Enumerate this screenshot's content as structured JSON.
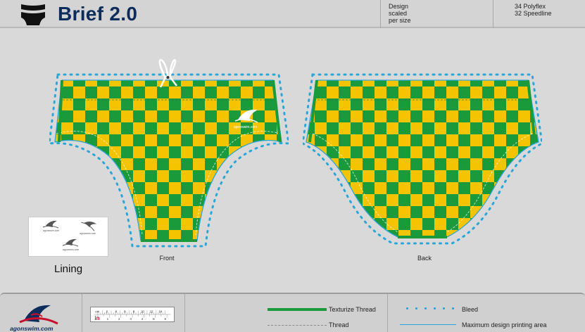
{
  "header": {
    "title": "Brief 2.0",
    "design_note": [
      "Design",
      "scaled",
      "per size"
    ],
    "fabric_note": [
      "34 Polyflex",
      "32 Speedline"
    ]
  },
  "views": {
    "front_label": "Front",
    "back_label": "Back"
  },
  "pattern": {
    "type": "checkerboard",
    "colors": [
      "#1b9a3c",
      "#f5c400"
    ]
  },
  "garment_text": {
    "logo_text": "agonswim.com"
  },
  "lining": {
    "label": "Lining",
    "logo_marks": [
      "agonswim.com",
      "agonswim.com",
      "agonswim.com"
    ]
  },
  "footer": {
    "brand": "agonswim.com",
    "ruler_unit_cm": "cm",
    "ruler_unit_in": "in",
    "ruler_cm_ticks": [
      "2",
      "4",
      "6",
      "8",
      "10",
      "12",
      "14"
    ],
    "ruler_in_ticks": [
      "1",
      "2",
      "3",
      "4",
      "5",
      "6"
    ],
    "legend": {
      "texturize": "Texturize Thread",
      "thread": "Thread",
      "bleed": "Bleed",
      "max_area": "Maximum design printing area"
    },
    "colors": {
      "texturize": "#1b9a3c",
      "bleed": "#2aa6d8",
      "max_area": "#2aa6d8",
      "thread": "#8a8a8a"
    }
  }
}
